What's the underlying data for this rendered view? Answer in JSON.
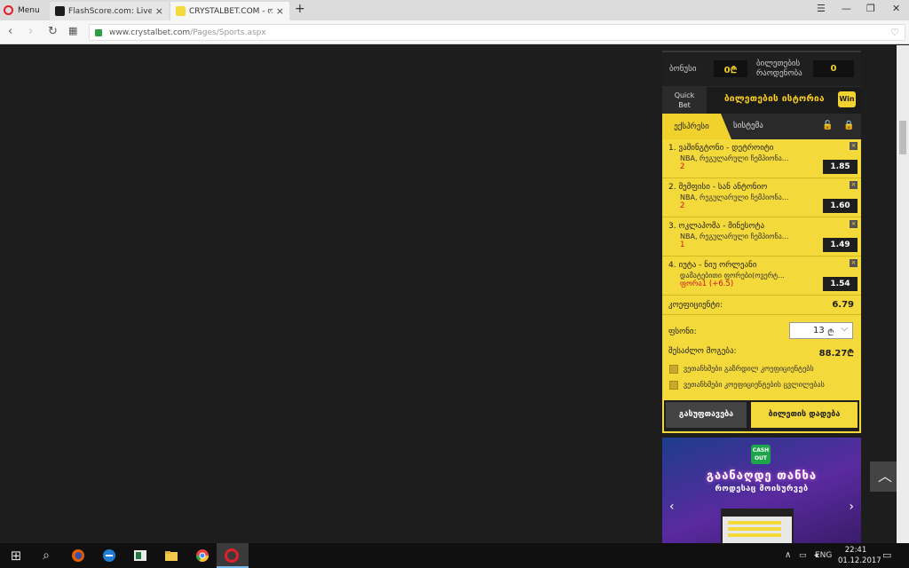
{
  "browser": {
    "menu_label": "Menu",
    "tabs": [
      {
        "title": "FlashScore.com: Live Socc",
        "active": false,
        "color": "#1b1b1b"
      },
      {
        "title": "CRYSTALBET.COM - ონლაი",
        "active": true,
        "color": "#f4d93a"
      }
    ],
    "url_domain": "www.crystalbet.com",
    "url_path": "/Pages/Sports.aspx",
    "controls": {
      "menu": "☰",
      "minimize": "—",
      "restore": "❐",
      "close": "✕",
      "back": "‹",
      "forward": "›",
      "reload": "↻",
      "speed_dial": "▦",
      "heart": "♡",
      "new_tab": "+",
      "tab_close": "×"
    }
  },
  "betslip": {
    "bonus_label": "ბონუსი",
    "bonus_value": "0₾",
    "tickets_label_1": "ბილეთების",
    "tickets_label_2": "რაოდენობა",
    "tickets_value": "0",
    "quick_bet_1": "Quick",
    "quick_bet_2": "Bet",
    "history_link": "ბილეთების ისტორია",
    "win_badge": "Win",
    "tab_express": "ექსპრესი",
    "tab_system": "სისტემა",
    "lock_icons": [
      "🔓",
      "🔒"
    ],
    "selections": [
      {
        "index": "1.",
        "match": "ვაშინგტონი - დეტროიტი",
        "league": "NBA, რეგულარული ჩემპიონა...",
        "pick": "2",
        "odd": "1.85"
      },
      {
        "index": "2.",
        "match": "მემფისი - სან ანტონიო",
        "league": "NBA, რეგულარული ჩემპიონა...",
        "pick": "2",
        "odd": "1.60"
      },
      {
        "index": "3.",
        "match": "ოკლაჰომა - მინესოტა",
        "league": "NBA, რეგულარული ჩემპიონა...",
        "pick": "1",
        "odd": "1.49"
      },
      {
        "index": "4.",
        "match": "იუტა - ნიუ ორლეანი",
        "league": "დამატებითი ფორები(ოვერტ...",
        "pick": "ფორა1 (+6.5)",
        "odd": "1.54"
      }
    ],
    "remove_symbol": "×",
    "coef_label": "კოეფიციენტი:",
    "coef_value": "6.79",
    "stake_label": "ფსონი:",
    "stake_value": "13",
    "stake_currency": "₾",
    "stake_chevron": "⌵",
    "possible_win_label": "შესაძლო მოგება:",
    "possible_win_value": "88.27₾",
    "agree_increased": "ვეთანხმები გაზრდილ კოეფიციენტებს",
    "agree_changes": "ვეთანხმები კოეფიციენტების ცვლილებას",
    "clear_button": "გასუფთავება",
    "place_button": "ბილეთის დადება"
  },
  "promo": {
    "badge_1": "CASH",
    "badge_2": "OUT",
    "headline": "გაანაღდე თანხა",
    "subline": "როდესაც მოისურვებ",
    "arrow_left": "‹",
    "arrow_right": "›"
  },
  "scroll_top": "︿",
  "taskbar": {
    "start": "⊞",
    "search": "⌕",
    "tray_up": "∧",
    "language": "ENG",
    "time": "22:41",
    "date": "01.12.2017",
    "notifications": "▭"
  }
}
